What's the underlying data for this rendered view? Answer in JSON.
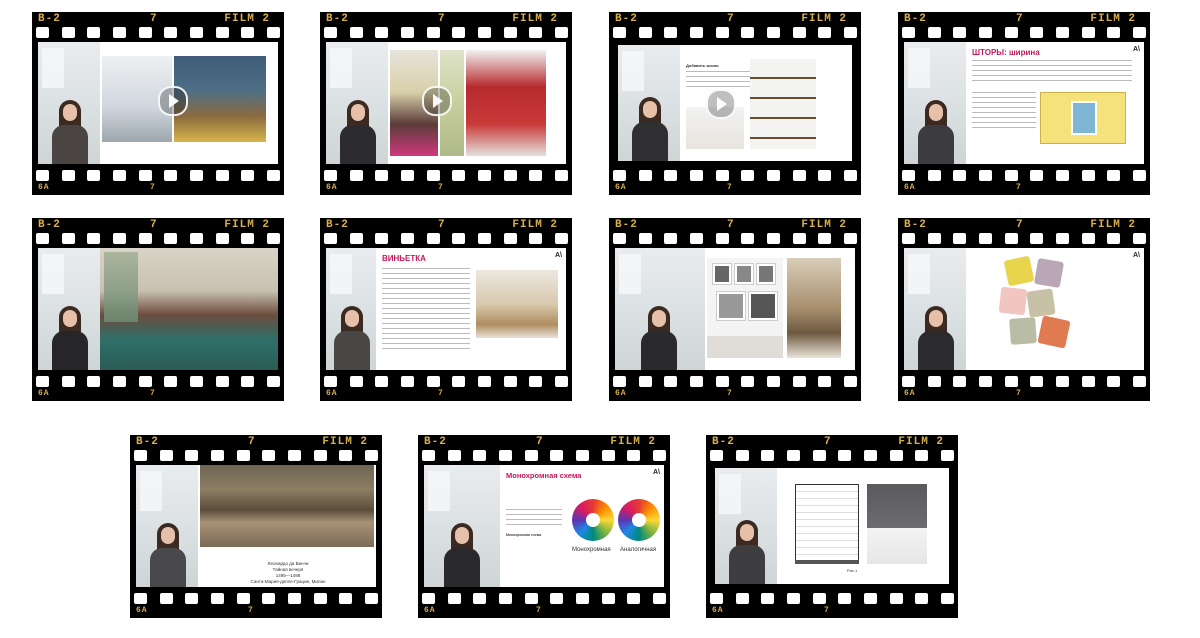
{
  "film_strip": {
    "top_left_code": "B-2",
    "top_middle_code": "7",
    "top_right_code": "FILM 2",
    "bottom_left_code": "6A",
    "bottom_middle_code": "7"
  },
  "frames": [
    {
      "id": "f1",
      "content": "video-interiors",
      "play_icon": true
    },
    {
      "id": "f2",
      "content": "video-interiors",
      "play_icon": true
    },
    {
      "id": "f3",
      "content": "slide-bookshelves",
      "play_icon": true,
      "slide_title": "Добавить жизни"
    },
    {
      "id": "f4",
      "content": "slide-curtains",
      "slide_title": "ШТОРЫ: ширина",
      "logo": "A\\"
    },
    {
      "id": "f5",
      "content": "photo-living-room"
    },
    {
      "id": "f6",
      "content": "slide-vignette",
      "slide_title": "ВИНЬЕТКА",
      "logo": "A\\"
    },
    {
      "id": "f7",
      "content": "photo-gallery-wall"
    },
    {
      "id": "f8",
      "content": "photo-pillows",
      "logo": "A\\"
    },
    {
      "id": "f9",
      "content": "slide-painting",
      "caption": [
        "Леонардо да Винчи",
        "Тайная вечеря",
        "1495—1498",
        "Санта-Мария-делле-Грацие, Милан"
      ]
    },
    {
      "id": "f10",
      "content": "slide-color-scheme",
      "slide_title": "Монохромная схема",
      "logo": "A\\",
      "wheel_labels": [
        "Монохромная",
        "Аналогичная"
      ],
      "bold_note": "Монохромная схема"
    },
    {
      "id": "f11",
      "content": "slide-blinds-drawing",
      "figure_label": "Рис.1"
    }
  ],
  "colors": {
    "film": "#000000",
    "film_text": "#d8b04a",
    "accent_title": "#c2185b"
  }
}
